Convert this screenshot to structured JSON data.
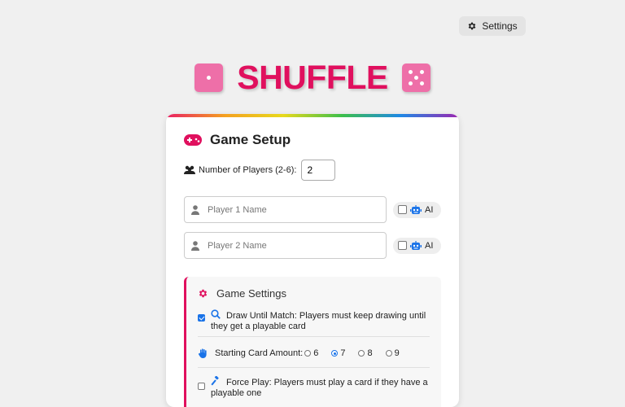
{
  "header": {
    "settings_label": "Settings"
  },
  "brand": {
    "title": "SHUFFLE",
    "accent_color": "#e0105e",
    "die_color": "#ee6fa8"
  },
  "setup": {
    "title": "Game Setup",
    "num_players_label": "Number of Players (2-6):",
    "num_players_value": "2",
    "players": [
      {
        "placeholder": "Player 1 Name",
        "ai_label": "AI",
        "ai_checked": false
      },
      {
        "placeholder": "Player 2 Name",
        "ai_label": "AI",
        "ai_checked": false
      }
    ]
  },
  "game_settings": {
    "title": "Game Settings",
    "draw_until_match": {
      "checked": true,
      "label": "Draw Until Match: Players must keep drawing until they get a playable card"
    },
    "starting_cards": {
      "label": "Starting Card Amount:",
      "options": [
        "6",
        "7",
        "8",
        "9"
      ],
      "selected": "7"
    },
    "force_play": {
      "checked": false,
      "label": "Force Play: Players must play a card if they have a playable one"
    }
  }
}
